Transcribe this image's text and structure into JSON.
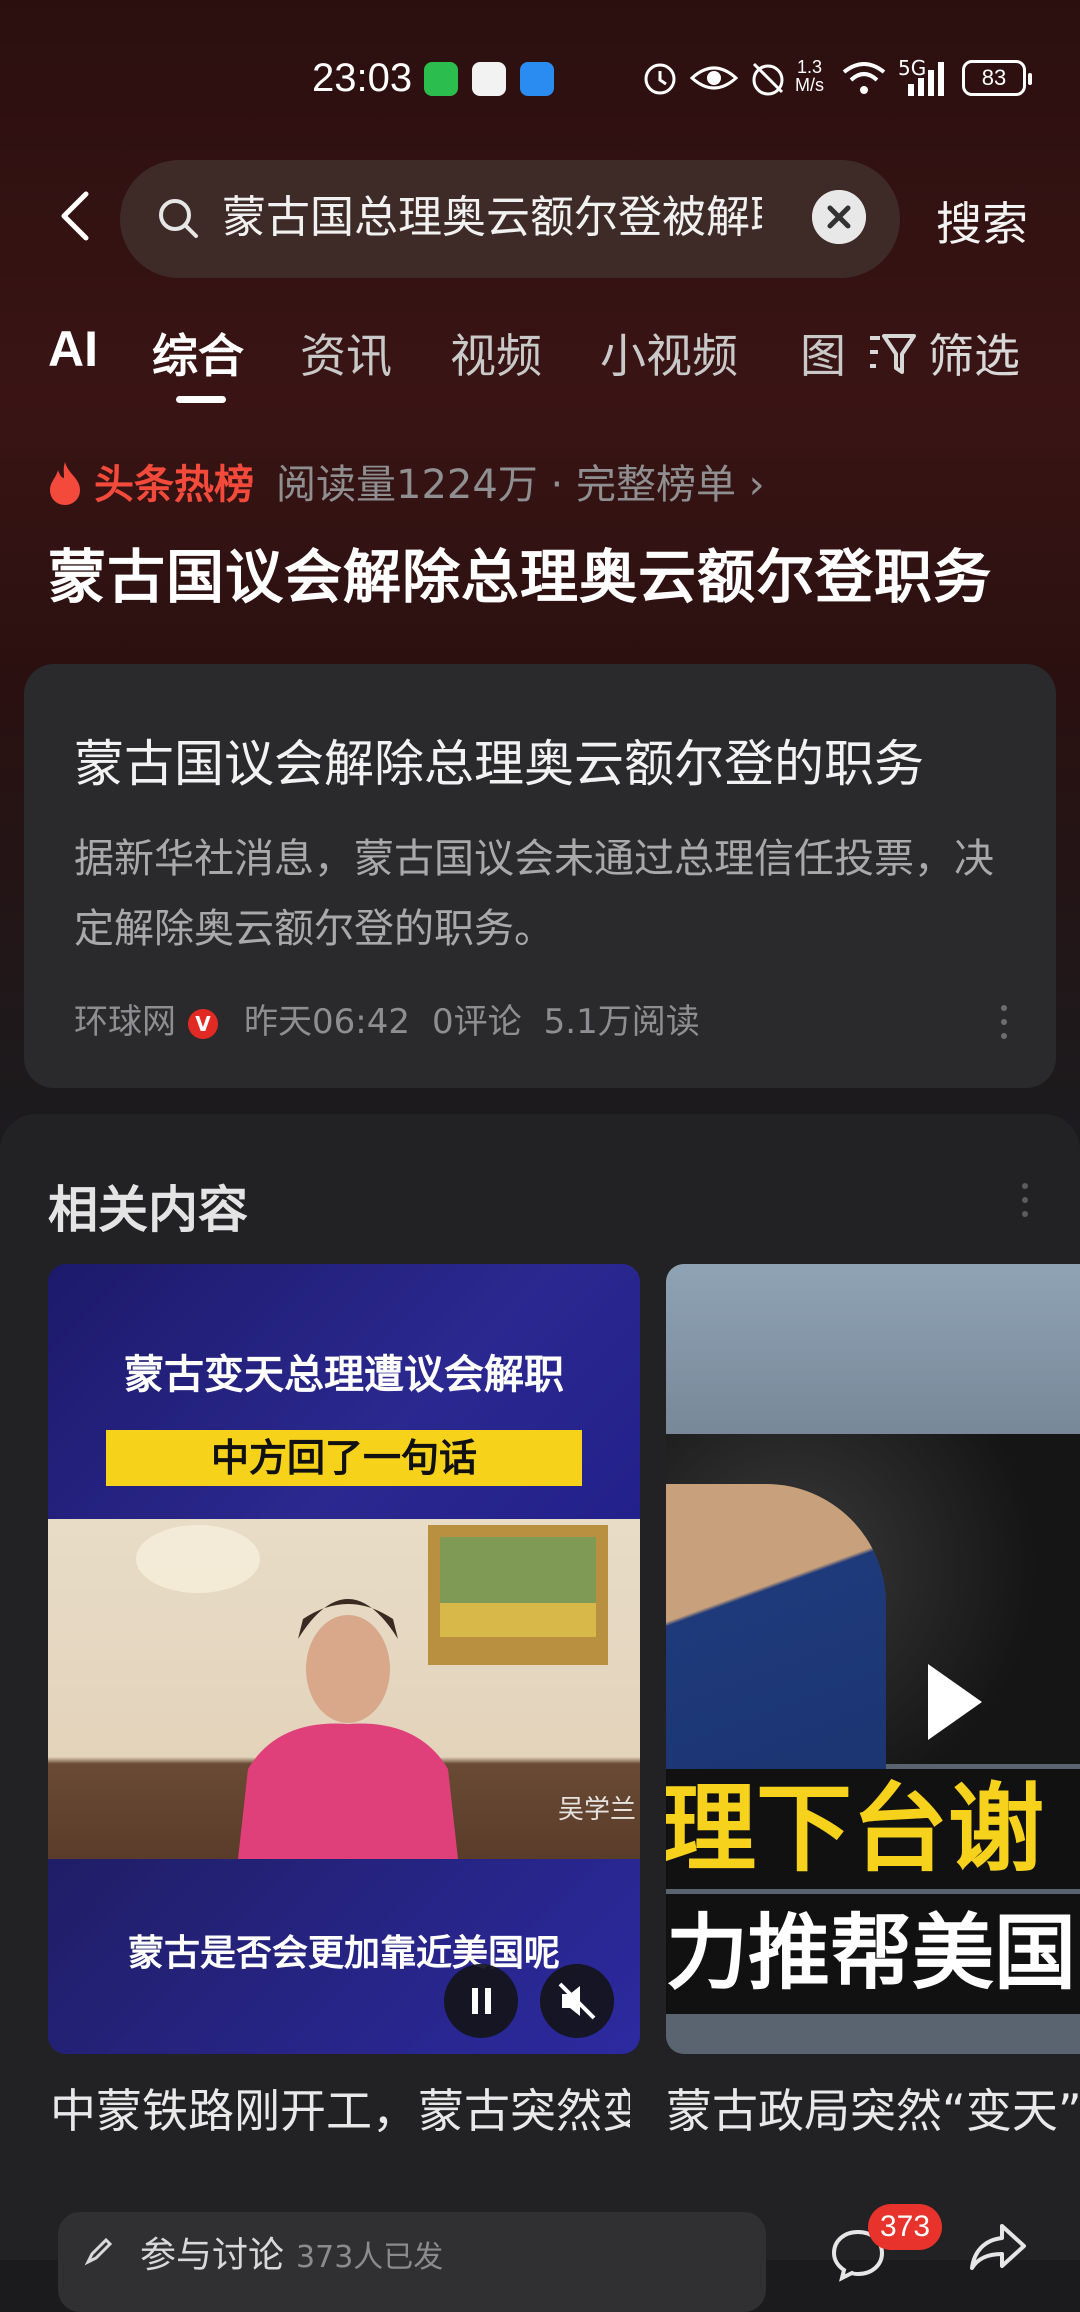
{
  "status_bar": {
    "time": "23:03",
    "speed_top": "1.3",
    "speed_bottom": "M/s",
    "network": "5G",
    "battery": "83"
  },
  "search": {
    "query": "蒙古国总理奥云额尔登被解职",
    "button": "搜索"
  },
  "tabs": [
    {
      "label": "AI"
    },
    {
      "label": "综合",
      "active": true
    },
    {
      "label": "资讯"
    },
    {
      "label": "视频"
    },
    {
      "label": "小视频"
    },
    {
      "label": "图"
    }
  ],
  "filter_label": "筛选",
  "hot": {
    "label": "头条热榜",
    "meta": "阅读量1224万 · 完整榜单 ›",
    "title": "蒙古国议会解除总理奥云额尔登职务"
  },
  "article": {
    "title": "蒙古国议会解除总理奥云额尔登的职务",
    "desc": "据新华社消息，蒙古国议会未通过总理信任投票，决定解除奥云额尔登的职务。",
    "source": "环球网",
    "badge": "V",
    "time": "昨天06:42",
    "comments": "0评论",
    "reads": "5.1万阅读"
  },
  "related": {
    "title": "相关内容",
    "items": [
      {
        "headline": "蒙古变天总理遭议会解职",
        "band": "中方回了一句话",
        "caption_overlay": "蒙古是否会更加靠近美国呢",
        "watermark": "吴学兰",
        "caption": "中蒙铁路刚开工，蒙古突然变天，总理遭议会解职"
      },
      {
        "overlay_line1": "理下台谢",
        "overlay_line2": "力推帮美国",
        "caption": "蒙古政局突然“变天”，总理下台谢罪，曾力推帮"
      }
    ]
  },
  "bottom": {
    "placeholder": "参与讨论",
    "participants": "373人已发",
    "comment_count": "373"
  },
  "colors": {
    "hot_red": "#f34a3b",
    "badge_red": "#e8332d",
    "band_yellow": "#f7d21a"
  }
}
